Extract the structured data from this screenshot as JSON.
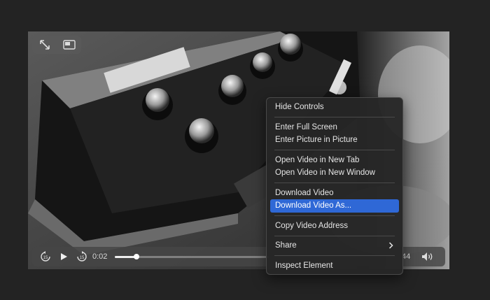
{
  "video": {
    "current_time": "0:02",
    "remaining_time_partial": "44",
    "progress": 0.14
  },
  "icons": {
    "expand": "expand-arrows-icon",
    "pip": "picture-in-picture-icon",
    "skip_back": "skip-back-15-icon",
    "play": "play-icon",
    "skip_forward": "skip-forward-15-icon",
    "volume": "volume-icon",
    "submenu": "chevron-right-icon"
  },
  "context_menu": {
    "hide_controls": "Hide Controls",
    "enter_full_screen": "Enter Full Screen",
    "enter_pip": "Enter Picture in Picture",
    "open_new_tab": "Open Video in New Tab",
    "open_new_window": "Open Video in New Window",
    "download_video": "Download Video",
    "download_video_as": "Download Video As...",
    "copy_address": "Copy Video Address",
    "share": "Share",
    "inspect": "Inspect Element",
    "highlight_color": "#2f68d6"
  }
}
